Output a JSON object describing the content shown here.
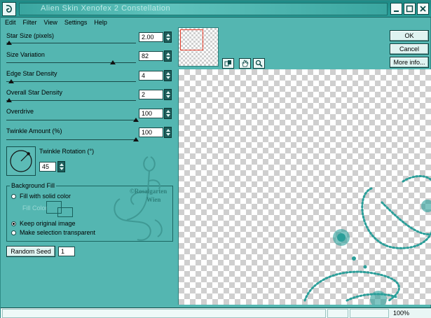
{
  "window": {
    "title": "Alien Skin Xenofex 2 Constellation"
  },
  "menu": [
    "Edit",
    "Filter",
    "View",
    "Settings",
    "Help"
  ],
  "sliders": [
    {
      "label": "Star Size (pixels)",
      "value": "2.00",
      "fraction": 0.02
    },
    {
      "label": "Size Variation",
      "value": "82",
      "fraction": 0.82
    },
    {
      "label": "Edge Star Density",
      "value": "4",
      "fraction": 0.04
    },
    {
      "label": "Overall Star Density",
      "value": "2",
      "fraction": 0.02
    },
    {
      "label": "Overdrive",
      "value": "100",
      "fraction": 1.0
    },
    {
      "label": "Twinkle Amount (%)",
      "value": "100",
      "fraction": 1.0
    }
  ],
  "rotation": {
    "label": "Twinkle Rotation (°)",
    "value": "45"
  },
  "background_fill": {
    "title": "Background Fill",
    "options": [
      {
        "label": "Fill with solid color",
        "selected": false
      },
      {
        "label": "Keep original image",
        "selected": true
      },
      {
        "label": "Make selection transparent",
        "selected": false
      }
    ],
    "fill_color_label": "Fill Color"
  },
  "random_seed": {
    "label": "Random Seed",
    "value": "1"
  },
  "buttons": {
    "ok": "OK",
    "cancel": "Cancel",
    "more_info": "More info..."
  },
  "watermark": {
    "line1": "©Rosalgarten",
    "line2": "Wien"
  },
  "status": {
    "zoom": "100%"
  },
  "colors": {
    "background": "#54b6b1",
    "title_bar": "#1e8a86",
    "accent_stars": "#2a9e99"
  },
  "icons": {
    "app": "ornament-icon",
    "minimize": "minimize-icon",
    "maximize": "maximize-icon",
    "close": "close-icon",
    "compare": "compare-icon",
    "hand": "hand-icon",
    "zoom": "zoom-icon"
  }
}
